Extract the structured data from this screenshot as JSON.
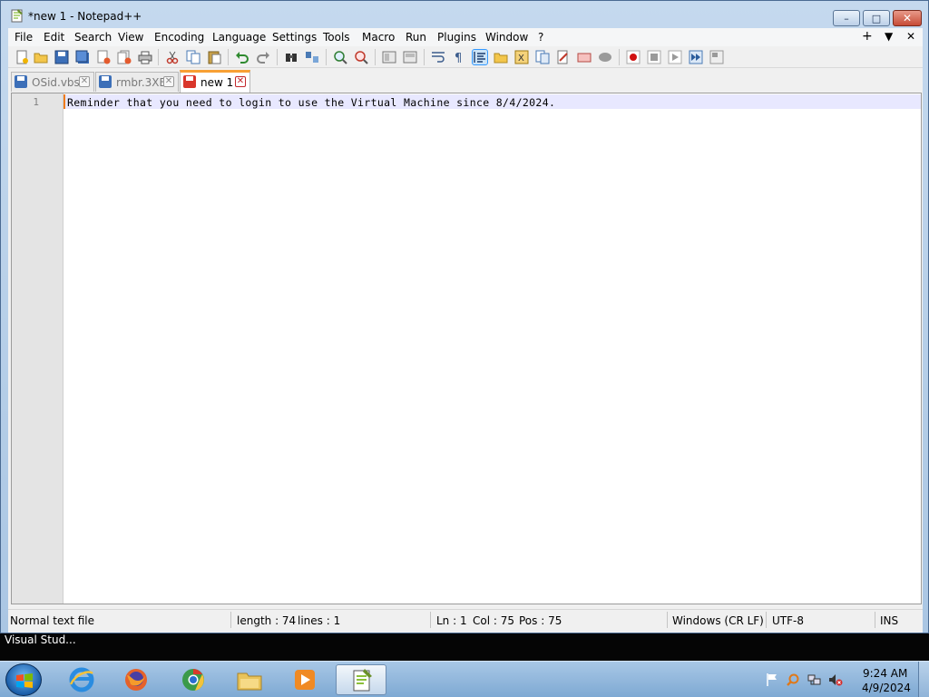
{
  "window": {
    "title": "*new 1 - Notepad++",
    "minimize_glyph": "–",
    "maximize_glyph": "□",
    "close_glyph": "✕"
  },
  "menubar": {
    "items": [
      "File",
      "Edit",
      "Search",
      "View",
      "Encoding",
      "Language",
      "Settings",
      "Tools",
      "Macro",
      "Run",
      "Plugins",
      "Window",
      "?"
    ],
    "right": [
      "+",
      "▼",
      "✕"
    ]
  },
  "toolbar": {
    "icons": [
      "new-icon",
      "open-icon",
      "save-icon",
      "save-all-icon",
      "close-icon",
      "close-all-icon",
      "print-icon",
      "cut-icon",
      "copy-icon",
      "paste-icon",
      "undo-icon",
      "redo-icon",
      "find-icon",
      "replace-icon",
      "zoom-in-icon",
      "zoom-out-icon",
      "sync-vertical-icon",
      "sync-horizontal-icon",
      "word-wrap-icon",
      "show-all-chars-icon",
      "indent-guide-icon",
      "folder-workspace-icon",
      "function-list-icon",
      "document-map-icon",
      "doc-list-icon",
      "monitoring-icon",
      "record-macro-icon",
      "stop-record-icon",
      "playback-icon",
      "run-multiple-icon",
      "save-macro-icon"
    ]
  },
  "tabs": [
    {
      "label": "OSid.vbs",
      "active": false,
      "close": "✕"
    },
    {
      "label": "rmbr.3XE",
      "active": false,
      "close": "✕"
    },
    {
      "label": "new 1",
      "active": true,
      "close": "✕"
    }
  ],
  "editor": {
    "line_number": "1",
    "content": "Reminder that you need to login to use the Virtual Machine since 8/4/2024."
  },
  "status": {
    "file_type": "Normal text file",
    "length": "length : 74",
    "lines": "lines : 1",
    "ln": "Ln : 1",
    "col": "Col : 75",
    "pos": "Pos : 75",
    "eol": "Windows (CR LF)",
    "encoding": "UTF-8",
    "mode": "INS"
  },
  "peek": {
    "text": "Visual Stud..."
  },
  "taskbar": {
    "apps": [
      "internet-explorer-icon",
      "firefox-icon",
      "chrome-icon",
      "file-explorer-icon",
      "media-player-icon",
      "notepadpp-icon"
    ],
    "time": "9:24 AM",
    "date": "4/9/2024"
  },
  "colors": {
    "accent_tab": "#f8a034",
    "current_line": "#e8e8ff",
    "gutter": "#e4e4e4"
  }
}
